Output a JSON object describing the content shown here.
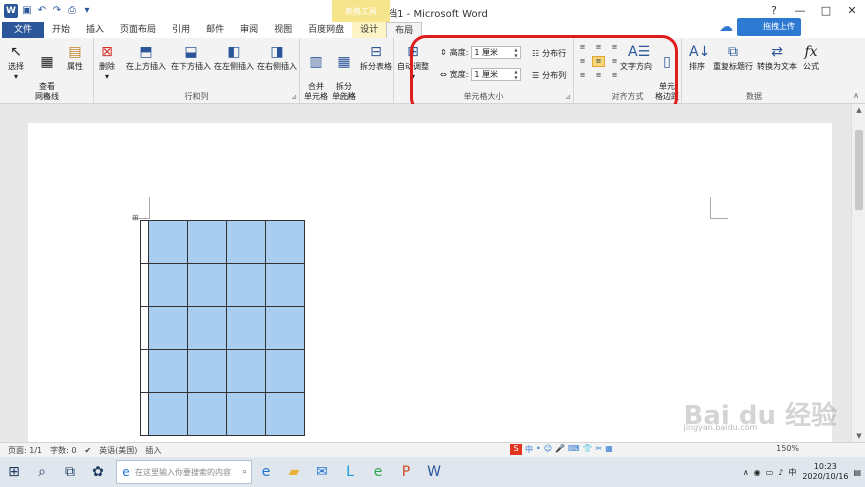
{
  "window": {
    "title": "文档1 - Microsoft Word",
    "context_tab_group": "表格工具",
    "upload_label": "拖拽上传",
    "controls": [
      "?",
      "—",
      "□",
      "✕"
    ]
  },
  "tabs": [
    "文件",
    "开始",
    "插入",
    "页面布局",
    "引用",
    "邮件",
    "审阅",
    "视图",
    "百度网盘",
    "设计",
    "布局"
  ],
  "active_tab": "布局",
  "ribbon": {
    "groups": {
      "table": {
        "label": "表",
        "buttons": [
          "选择",
          "查看\n网格线",
          "属性"
        ]
      },
      "rows_cols": {
        "label": "行和列",
        "buttons": [
          "删除",
          "在上方插入",
          "在下方插入",
          "在左侧插入",
          "在右侧插入"
        ]
      },
      "merge": {
        "label": "合并",
        "buttons": [
          "合并\n单元格",
          "拆分\n单元格",
          "拆分表格"
        ]
      },
      "cell_size": {
        "label": "单元格大小",
        "autofit": "自动调整",
        "height_label": "高度:",
        "height_value": "1 厘米",
        "width_label": "宽度:",
        "width_value": "1 厘米",
        "distribute_rows": "分布行",
        "distribute_cols": "分布列"
      },
      "alignment": {
        "label": "对齐方式",
        "text_direction": "文字方向",
        "cell_margins": "单元\n格边距",
        "selected_index": 4
      },
      "data": {
        "label": "数据",
        "buttons": [
          "排序",
          "重复标题行",
          "转换为文本",
          "公式"
        ]
      }
    }
  },
  "document": {
    "table": {
      "rows": 5,
      "cols": 4
    }
  },
  "status_bar": {
    "page": "页面: 1/1",
    "words": "字数: 0",
    "language": "英语(美国)",
    "mode": "插入",
    "zoom": "150%"
  },
  "ime": [
    "中",
    "•",
    "☺",
    "🎤",
    "⌨",
    "👕",
    "✂",
    "▦"
  ],
  "taskbar": {
    "search_placeholder": "在这里输入你要搜索的内容",
    "time": "10:23",
    "date": "2020/10/16",
    "lang": "中"
  },
  "watermark": {
    "main": "Bai du 经验",
    "sub": "jingyan.baidu.com"
  }
}
